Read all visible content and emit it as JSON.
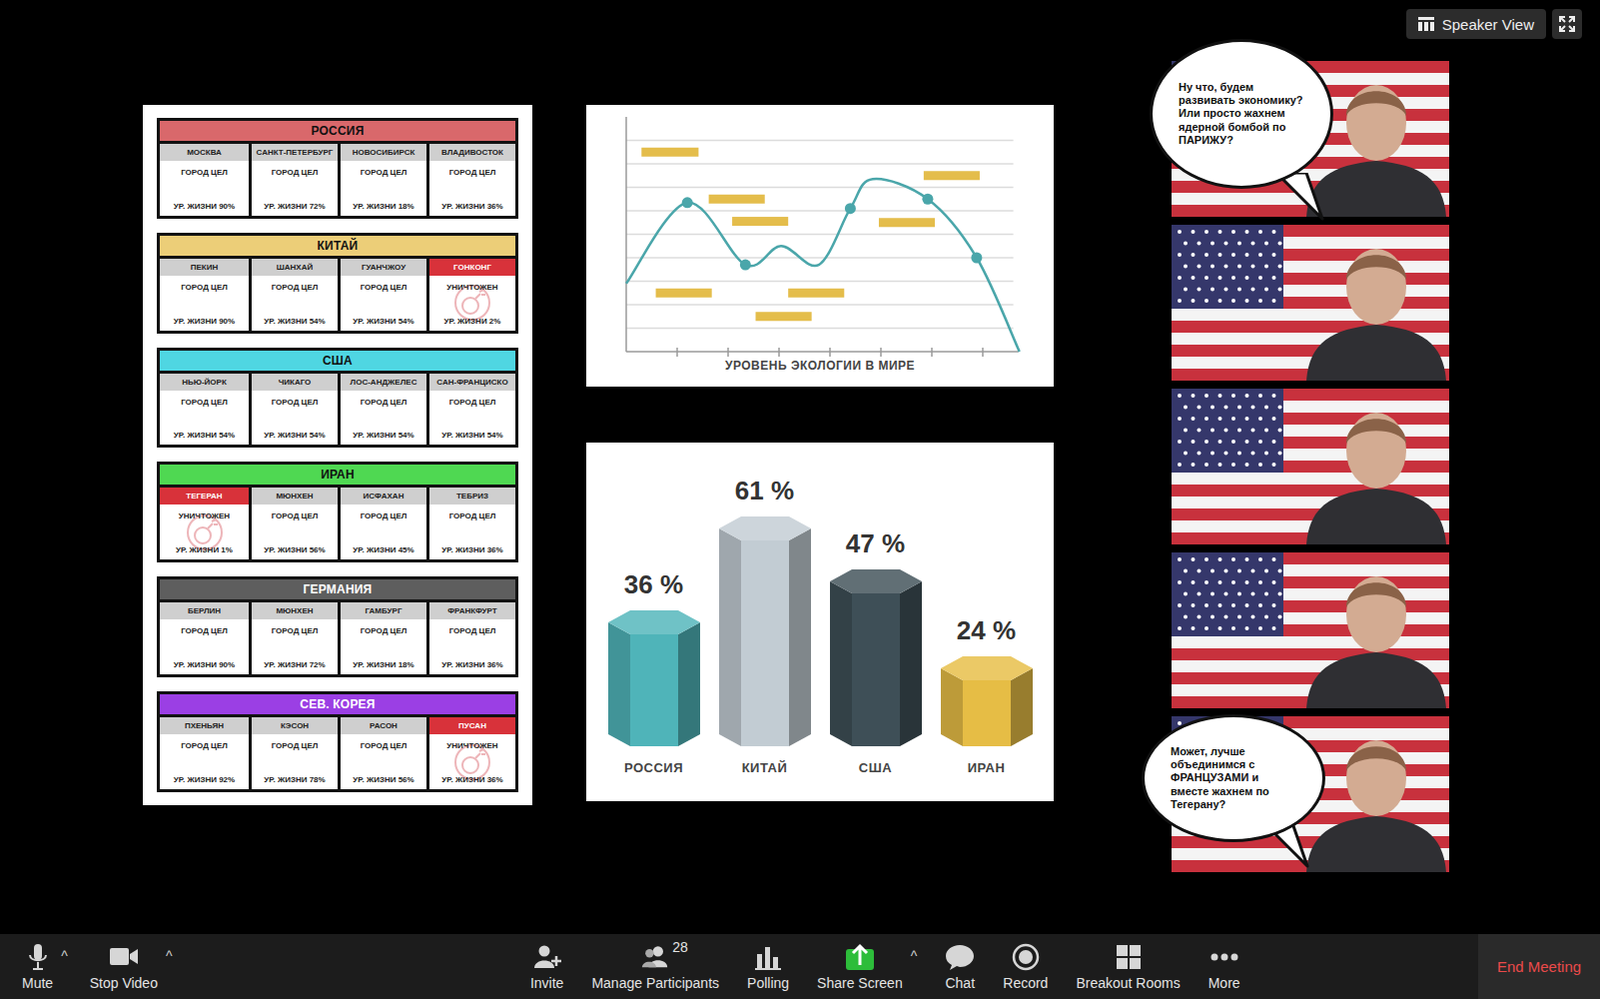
{
  "top_bar": {
    "view_button": "Speaker View"
  },
  "shared_screen": {
    "countries": [
      {
        "name": "РОССИЯ",
        "color": "#d9686b",
        "cities": [
          {
            "name": "МОСКВА",
            "status": "ГОРОД ЦЕЛ",
            "life": "УР. ЖИЗНИ 90%",
            "destroyed": false
          },
          {
            "name": "САНКТ-ПЕТЕРБУРГ",
            "status": "ГОРОД ЦЕЛ",
            "life": "УР. ЖИЗНИ 72%",
            "destroyed": false
          },
          {
            "name": "НОВОСИБИРСК",
            "status": "ГОРОД ЦЕЛ",
            "life": "УР. ЖИЗНИ 18%",
            "destroyed": false
          },
          {
            "name": "ВЛАДИВОСТОК",
            "status": "ГОРОД ЦЕЛ",
            "life": "УР. ЖИЗНИ 36%",
            "destroyed": false
          }
        ]
      },
      {
        "name": "КИТАЙ",
        "color": "#ecce78",
        "cities": [
          {
            "name": "ПЕКИН",
            "status": "ГОРОД ЦЕЛ",
            "life": "УР. ЖИЗНИ 90%",
            "destroyed": false
          },
          {
            "name": "ШАНХАЙ",
            "status": "ГОРОД ЦЕЛ",
            "life": "УР. ЖИЗНИ 54%",
            "destroyed": false
          },
          {
            "name": "ГУАНЧЖОУ",
            "status": "ГОРОД ЦЕЛ",
            "life": "УР. ЖИЗНИ 54%",
            "destroyed": false
          },
          {
            "name": "ГОНКОНГ",
            "status": "УНИЧТОЖЕН",
            "life": "УР. ЖИЗНИ 2%",
            "destroyed": true
          }
        ]
      },
      {
        "name": "США",
        "color": "#4fd6e2",
        "cities": [
          {
            "name": "НЬЮ-ЙОРК",
            "status": "ГОРОД ЦЕЛ",
            "life": "УР. ЖИЗНИ 54%",
            "destroyed": false
          },
          {
            "name": "ЧИКАГО",
            "status": "ГОРОД ЦЕЛ",
            "life": "УР. ЖИЗНИ 54%",
            "destroyed": false
          },
          {
            "name": "ЛОС-АНДЖЕЛЕС",
            "status": "ГОРОД ЦЕЛ",
            "life": "УР. ЖИЗНИ 54%",
            "destroyed": false
          },
          {
            "name": "САН-ФРАНЦИСКО",
            "status": "ГОРОД ЦЕЛ",
            "life": "УР. ЖИЗНИ 54%",
            "destroyed": false
          }
        ]
      },
      {
        "name": "ИРАН",
        "color": "#4fd852",
        "cities": [
          {
            "name": "ТЕГЕРАН",
            "status": "УНИЧТОЖЕН",
            "life": "УР. ЖИЗНИ 1%",
            "destroyed": true
          },
          {
            "name": "МЮНХЕН",
            "status": "ГОРОД ЦЕЛ",
            "life": "УР. ЖИЗНИ 56%",
            "destroyed": false
          },
          {
            "name": "ИСФАХАН",
            "status": "ГОРОД ЦЕЛ",
            "life": "УР. ЖИЗНИ 45%",
            "destroyed": false
          },
          {
            "name": "ТЕБРИЗ",
            "status": "ГОРОД ЦЕЛ",
            "life": "УР. ЖИЗНИ 36%",
            "destroyed": false
          }
        ]
      },
      {
        "name": "ГЕРМАНИЯ",
        "color": "#5e5e5e",
        "cities": [
          {
            "name": "БЕРЛИН",
            "status": "ГОРОД ЦЕЛ",
            "life": "УР. ЖИЗНИ 90%",
            "destroyed": false
          },
          {
            "name": "МЮНХЕН",
            "status": "ГОРОД ЦЕЛ",
            "life": "УР. ЖИЗНИ 72%",
            "destroyed": false
          },
          {
            "name": "ГАМБУРГ",
            "status": "ГОРОД ЦЕЛ",
            "life": "УР. ЖИЗНИ 18%",
            "destroyed": false
          },
          {
            "name": "ФРАНКФУРТ",
            "status": "ГОРОД ЦЕЛ",
            "life": "УР. ЖИЗНИ 36%",
            "destroyed": false
          }
        ]
      },
      {
        "name": "СЕВ. КОРЕЯ",
        "color": "#9b3fe4",
        "cities": [
          {
            "name": "ПХЕНЬЯН",
            "status": "ГОРОД ЦЕЛ",
            "life": "УР. ЖИЗНИ 92%",
            "destroyed": false
          },
          {
            "name": "КЭСОН",
            "status": "ГОРОД ЦЕЛ",
            "life": "УР. ЖИЗНИ 78%",
            "destroyed": false
          },
          {
            "name": "РАСОН",
            "status": "ГОРОД ЦЕЛ",
            "life": "УР. ЖИЗНИ 56%",
            "destroyed": false
          },
          {
            "name": "ПУСАН",
            "status": "УНИЧТОЖЕН",
            "life": "УР. ЖИЗНИ 36%",
            "destroyed": true
          }
        ]
      }
    ],
    "line_chart": {
      "title": "УРОВЕНЬ ЭКОЛОГИИ В МИРЕ",
      "x_ticks": [
        1,
        2,
        3,
        4,
        5,
        6,
        7
      ],
      "y_grid": [
        1,
        2,
        3,
        4,
        5,
        6,
        7,
        8,
        9
      ],
      "series": [
        {
          "x": [
            0,
            1.2,
            2.34,
            3.04,
            3.78,
            4.4,
            4.84,
            5.92,
            6.88,
            7.72
          ],
          "y": [
            2.9,
            6.35,
            3.7,
            4.5,
            3.7,
            6.1,
            7.35,
            6.5,
            4.0,
            0
          ],
          "marked": [
            false,
            true,
            true,
            false,
            false,
            true,
            false,
            true,
            true,
            false
          ]
        }
      ],
      "annotations": [
        {
          "x1": 0.3,
          "x2": 1.42,
          "y": 8.5
        },
        {
          "x1": 1.62,
          "x2": 2.72,
          "y": 6.5
        },
        {
          "x1": 2.08,
          "x2": 3.18,
          "y": 5.55
        },
        {
          "x1": 0.58,
          "x2": 1.68,
          "y": 2.5
        },
        {
          "x1": 3.18,
          "x2": 4.28,
          "y": 2.5
        },
        {
          "x1": 2.54,
          "x2": 3.64,
          "y": 1.5
        },
        {
          "x1": 4.96,
          "x2": 6.06,
          "y": 5.5
        },
        {
          "x1": 5.84,
          "x2": 6.94,
          "y": 7.5
        }
      ]
    },
    "bar_chart": {
      "bars": [
        {
          "label": "РОССИЯ",
          "value": 36,
          "reading": "36 %",
          "color": "#4fb4b9"
        },
        {
          "label": "КИТАЙ",
          "value": 61,
          "reading": "61 %",
          "color": "#c2ccd3"
        },
        {
          "label": "США",
          "value": 47,
          "reading": "47 %",
          "color": "#3e4f57"
        },
        {
          "label": "ИРАН",
          "value": 24,
          "reading": "24 %",
          "color": "#e6bd45"
        }
      ]
    }
  },
  "participants": [
    {
      "speech": "Ну что, будем развивать экономику? Или просто жахнем ядерной бомбой по ПАРИЖУ?"
    },
    {},
    {},
    {},
    {
      "speech": "Может, лучше объединимся с ФРАНЦУЗАМИ и вместе жахнем по Тегерану?"
    }
  ],
  "toolbar": {
    "left": [
      {
        "label": "Mute",
        "caret": "^"
      },
      {
        "label": "Stop Video",
        "caret": "^"
      }
    ],
    "center": [
      {
        "label": "Invite"
      },
      {
        "label": "Manage Participants",
        "badge": "28"
      },
      {
        "label": "Polling"
      },
      {
        "label": "Share Screen",
        "caret": "^"
      },
      {
        "label": "Chat"
      },
      {
        "label": "Record"
      },
      {
        "label": "Breakout Rooms"
      },
      {
        "label": "More"
      }
    ],
    "end_button": "End Meeting"
  }
}
